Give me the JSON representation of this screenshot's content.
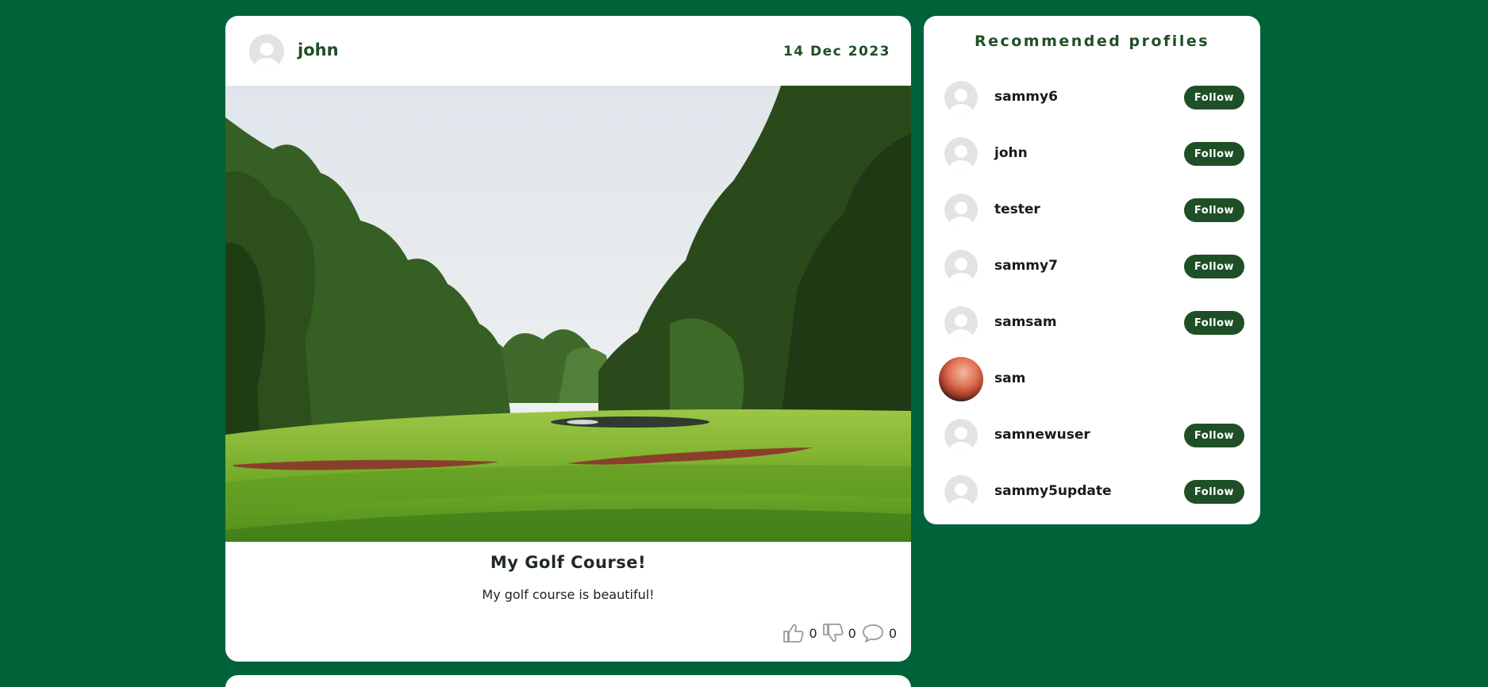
{
  "post": {
    "author": "john",
    "date": "14 Dec 2023",
    "title": "My Golf Course!",
    "body": "My golf course is beautiful!",
    "likes": "0",
    "dislikes": "0",
    "comments": "0"
  },
  "recommended": {
    "title": "Recommended profiles",
    "follow_label": "Follow",
    "profiles": [
      {
        "name": "sammy6",
        "can_follow": true
      },
      {
        "name": "john",
        "can_follow": true
      },
      {
        "name": "tester",
        "can_follow": true
      },
      {
        "name": "sammy7",
        "can_follow": true
      },
      {
        "name": "samsam",
        "can_follow": true
      },
      {
        "name": "sam",
        "can_follow": false
      },
      {
        "name": "samnewuser",
        "can_follow": true
      },
      {
        "name": "sammy5update",
        "can_follow": true
      }
    ]
  },
  "icons": {
    "avatar": "default-avatar-icon",
    "like": "thumbs-up-icon",
    "dislike": "thumbs-down-icon",
    "comment": "comment-bubble-icon"
  },
  "colors": {
    "page_background": "#006239",
    "accent": "#1f4f26",
    "card": "#ffffff"
  }
}
